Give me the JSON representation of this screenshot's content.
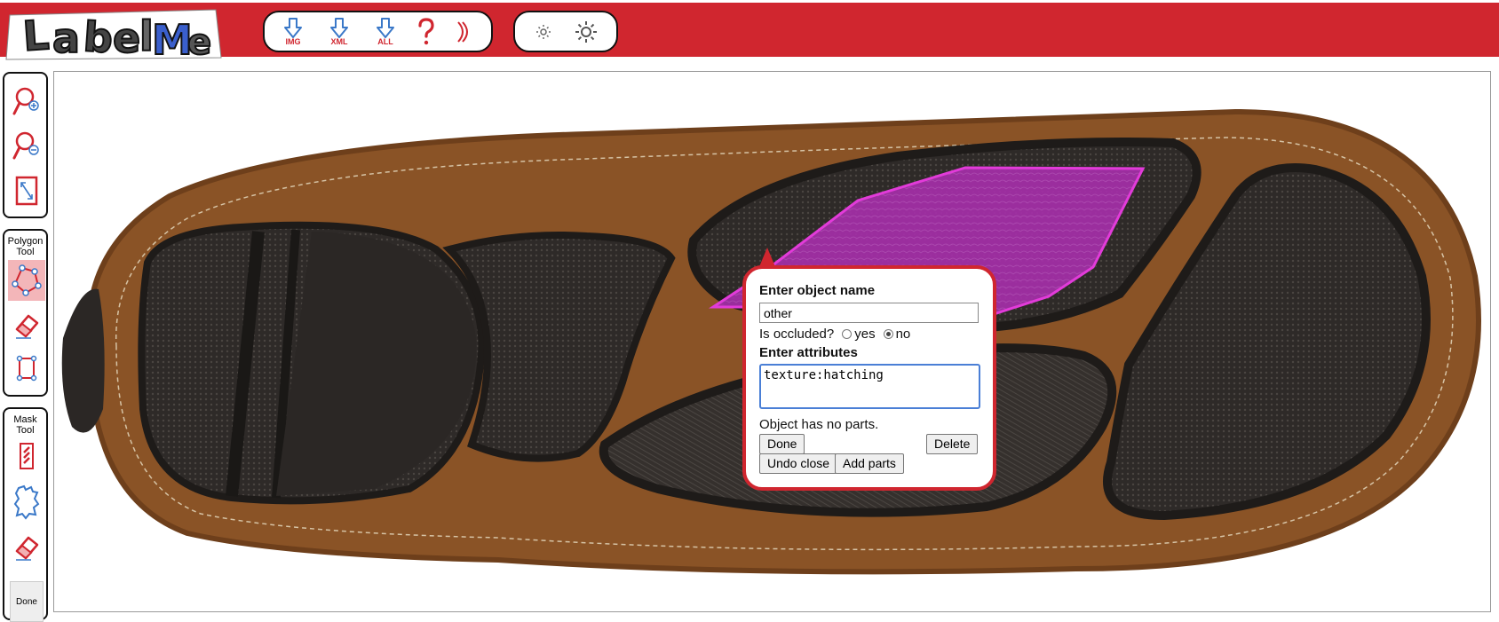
{
  "app": {
    "logo_text": "LabelMe"
  },
  "toolbar": {
    "download_img_label": "IMG",
    "download_xml_label": "XML",
    "download_all_label": "ALL"
  },
  "sidebar": {
    "polygon_tool_label": "Polygon Tool",
    "mask_tool_label": "Mask Tool",
    "done_label": "Done"
  },
  "popup": {
    "title": "Enter object name",
    "name_value": "other",
    "occluded_label": "Is occluded?",
    "occluded_yes": "yes",
    "occluded_no": "no",
    "occluded_selected": "no",
    "attributes_title": "Enter attributes",
    "attributes_value": "texture:hatching",
    "parts_text": "Object has no parts.",
    "done_button": "Done",
    "delete_button": "Delete",
    "undo_close_button": "Undo close",
    "add_parts_button": "Add parts"
  },
  "colors": {
    "brand_red": "#d0262f",
    "polygon_stroke": "#e23bd9",
    "polygon_fill": "#a42ea8",
    "icon_blue": "#3a78c8"
  }
}
